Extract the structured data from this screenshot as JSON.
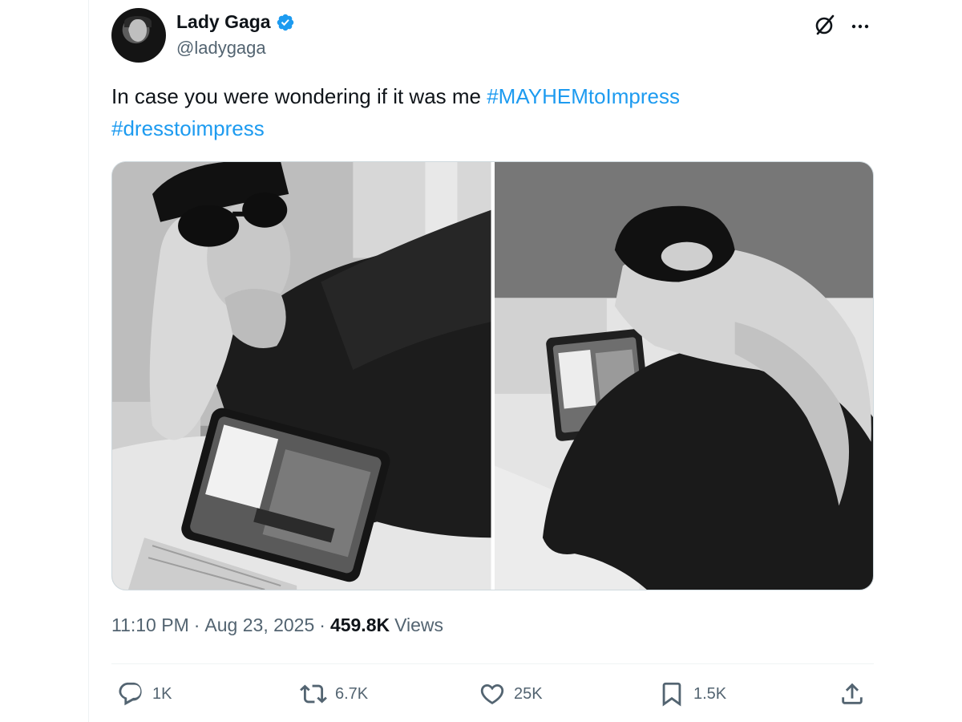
{
  "author": {
    "name": "Lady Gaga",
    "handle": "@ladygaga",
    "verified": true,
    "verified_color": "#1d9bf0"
  },
  "tweet": {
    "text_plain": "In case you were wondering if it was me ",
    "hashtags": [
      "#MAYHEMtoImpress",
      "#dresstoimpress"
    ],
    "hashtag_color": "#1d9bf0",
    "media": [
      {
        "name": "photo-selfie-with-tablet"
      },
      {
        "name": "photo-back-view-playing-tablet"
      }
    ]
  },
  "meta": {
    "time": "11:10 PM",
    "separator": "·",
    "date": "Aug 23, 2025",
    "views_count": "459.8K",
    "views_label": "Views"
  },
  "actions": {
    "replies": "1K",
    "reposts": "6.7K",
    "likes": "25K",
    "bookmarks": "1.5K"
  },
  "icons": {
    "grok": "grok-icon",
    "more": "more-icon",
    "reply": "reply-icon",
    "repost": "repost-icon",
    "like": "heart-icon",
    "bookmark": "bookmark-icon",
    "share": "share-icon"
  }
}
